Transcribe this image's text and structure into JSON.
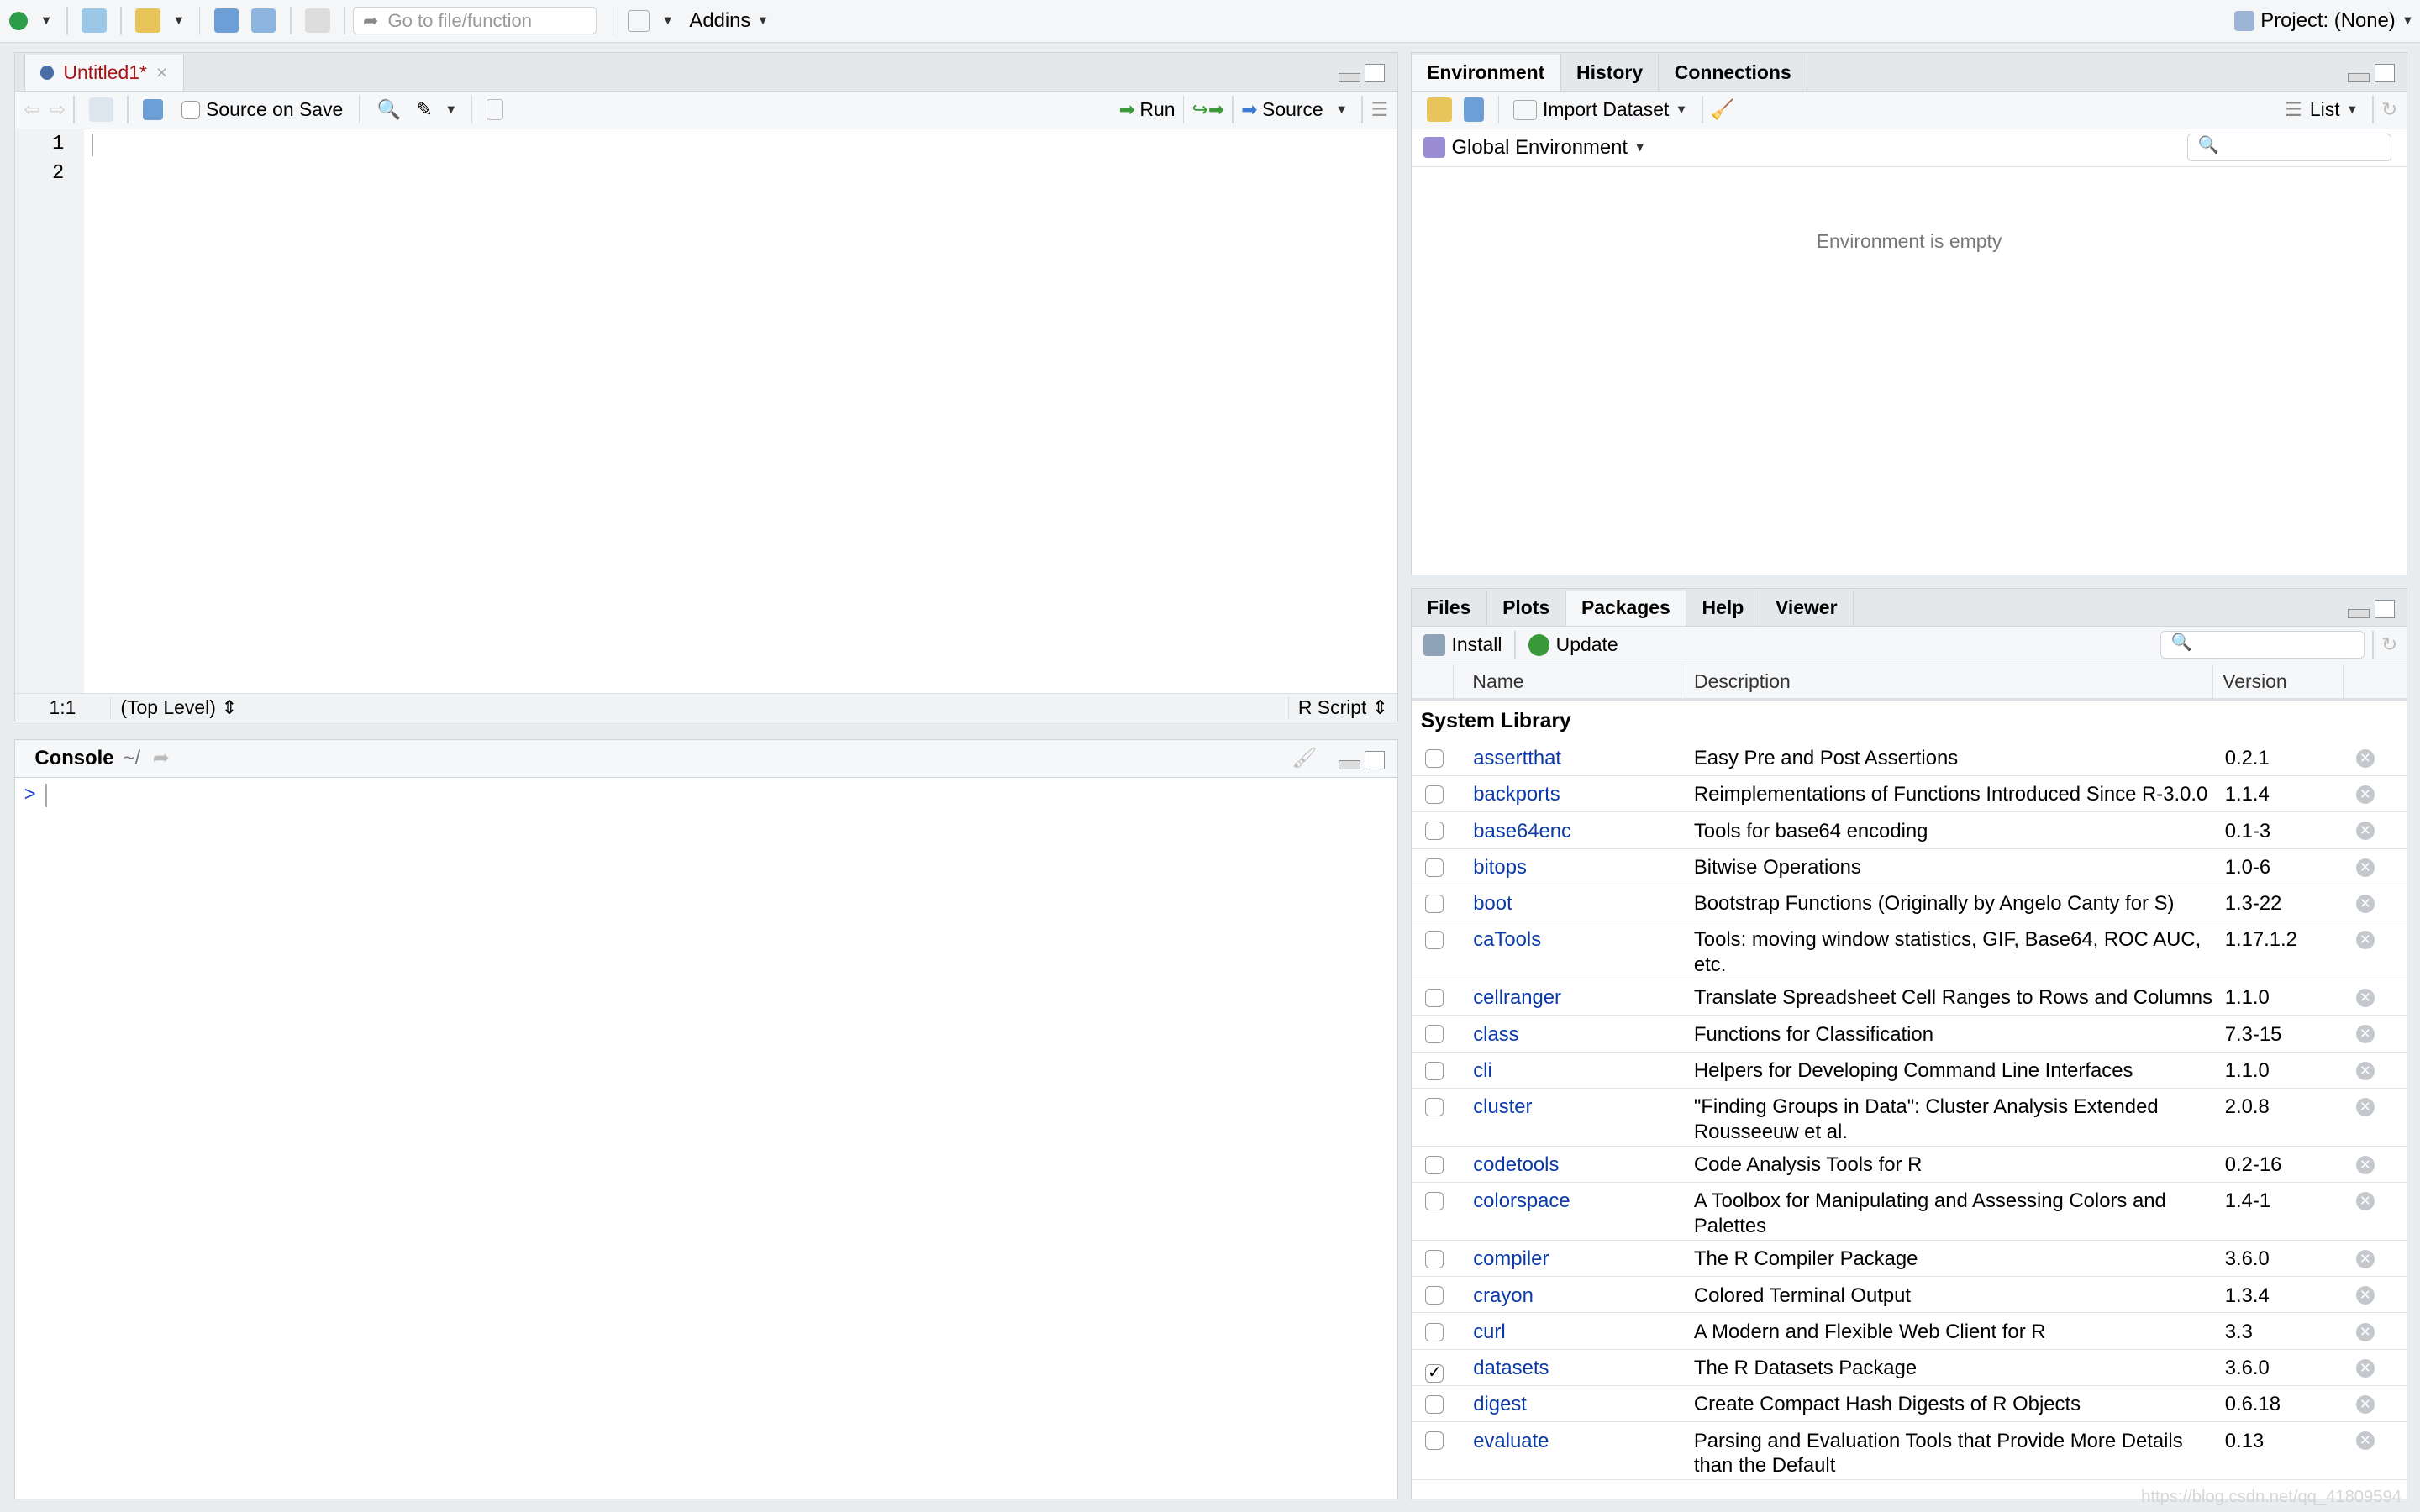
{
  "topbar": {
    "goto_placeholder": "Go to file/function",
    "addins": "Addins",
    "project": "Project: (None)"
  },
  "editor": {
    "tab": "Untitled1*",
    "source_on_save": "Source on Save",
    "run": "Run",
    "source": "Source",
    "lines": [
      "1",
      "2"
    ],
    "status_pos": "1:1",
    "status_scope": "(Top Level)",
    "status_type": "R Script"
  },
  "console": {
    "title": "Console",
    "path": "~/",
    "prompt": ">"
  },
  "env": {
    "tabs": [
      "Environment",
      "History",
      "Connections"
    ],
    "import": "Import Dataset",
    "list": "List",
    "scope": "Global Environment",
    "empty": "Environment is empty"
  },
  "files": {
    "tabs": [
      "Files",
      "Plots",
      "Packages",
      "Help",
      "Viewer"
    ],
    "install": "Install",
    "update": "Update",
    "columns": [
      "Name",
      "Description",
      "Version"
    ],
    "section": "System Library",
    "packages": [
      {
        "name": "assertthat",
        "desc": "Easy Pre and Post Assertions",
        "ver": "0.2.1",
        "checked": false
      },
      {
        "name": "backports",
        "desc": "Reimplementations of Functions Introduced Since R-3.0.0",
        "ver": "1.1.4",
        "checked": false
      },
      {
        "name": "base64enc",
        "desc": "Tools for base64 encoding",
        "ver": "0.1-3",
        "checked": false
      },
      {
        "name": "bitops",
        "desc": "Bitwise Operations",
        "ver": "1.0-6",
        "checked": false
      },
      {
        "name": "boot",
        "desc": "Bootstrap Functions (Originally by Angelo Canty for S)",
        "ver": "1.3-22",
        "checked": false
      },
      {
        "name": "caTools",
        "desc": "Tools: moving window statistics, GIF, Base64, ROC AUC, etc.",
        "ver": "1.17.1.2",
        "checked": false
      },
      {
        "name": "cellranger",
        "desc": "Translate Spreadsheet Cell Ranges to Rows and Columns",
        "ver": "1.1.0",
        "checked": false
      },
      {
        "name": "class",
        "desc": "Functions for Classification",
        "ver": "7.3-15",
        "checked": false
      },
      {
        "name": "cli",
        "desc": "Helpers for Developing Command Line Interfaces",
        "ver": "1.1.0",
        "checked": false
      },
      {
        "name": "cluster",
        "desc": "\"Finding Groups in Data\": Cluster Analysis Extended Rousseeuw et al.",
        "ver": "2.0.8",
        "checked": false
      },
      {
        "name": "codetools",
        "desc": "Code Analysis Tools for R",
        "ver": "0.2-16",
        "checked": false
      },
      {
        "name": "colorspace",
        "desc": "A Toolbox for Manipulating and Assessing Colors and Palettes",
        "ver": "1.4-1",
        "checked": false
      },
      {
        "name": "compiler",
        "desc": "The R Compiler Package",
        "ver": "3.6.0",
        "checked": false
      },
      {
        "name": "crayon",
        "desc": "Colored Terminal Output",
        "ver": "1.3.4",
        "checked": false
      },
      {
        "name": "curl",
        "desc": "A Modern and Flexible Web Client for R",
        "ver": "3.3",
        "checked": false
      },
      {
        "name": "datasets",
        "desc": "The R Datasets Package",
        "ver": "3.6.0",
        "checked": true
      },
      {
        "name": "digest",
        "desc": "Create Compact Hash Digests of R Objects",
        "ver": "0.6.18",
        "checked": false
      },
      {
        "name": "evaluate",
        "desc": "Parsing and Evaluation Tools that Provide More Details than the Default",
        "ver": "0.13",
        "checked": false
      }
    ]
  },
  "watermark": "https://blog.csdn.net/qq_41809594"
}
